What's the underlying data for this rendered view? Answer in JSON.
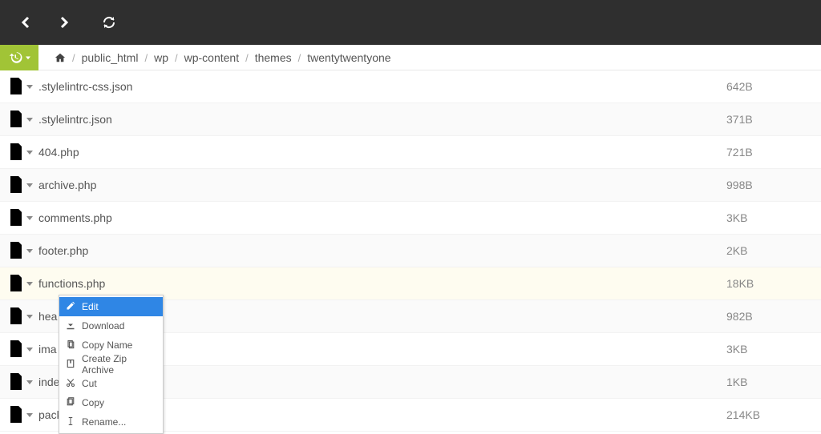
{
  "breadcrumb": [
    "public_html",
    "wp",
    "wp-content",
    "themes",
    "twentytwentyone"
  ],
  "files": [
    {
      "name": ".stylelintrc-css.json",
      "size": "642B",
      "highlight": false
    },
    {
      "name": ".stylelintrc.json",
      "size": "371B",
      "highlight": false
    },
    {
      "name": "404.php",
      "size": "721B",
      "highlight": false
    },
    {
      "name": "archive.php",
      "size": "998B",
      "highlight": false
    },
    {
      "name": "comments.php",
      "size": "3KB",
      "highlight": false
    },
    {
      "name": "footer.php",
      "size": "2KB",
      "highlight": false
    },
    {
      "name": "functions.php",
      "size": "18KB",
      "highlight": true
    },
    {
      "name": "hea",
      "size": "982B",
      "highlight": false
    },
    {
      "name": "ima",
      "size": "3KB",
      "highlight": false
    },
    {
      "name": "inde",
      "size": "1KB",
      "highlight": false
    },
    {
      "name": "pack",
      "size": "214KB",
      "highlight": false
    }
  ],
  "context_menu": {
    "items": [
      {
        "label": "Edit",
        "icon": "edit",
        "hover": true
      },
      {
        "label": "Download",
        "icon": "download",
        "hover": false
      },
      {
        "label": "Copy Name",
        "icon": "copyname",
        "hover": false
      },
      {
        "label": "Create Zip Archive",
        "icon": "zip",
        "hover": false
      },
      {
        "label": "Cut",
        "icon": "cut",
        "hover": false
      },
      {
        "label": "Copy",
        "icon": "copy",
        "hover": false
      },
      {
        "label": "Rename...",
        "icon": "rename",
        "hover": false
      }
    ]
  }
}
